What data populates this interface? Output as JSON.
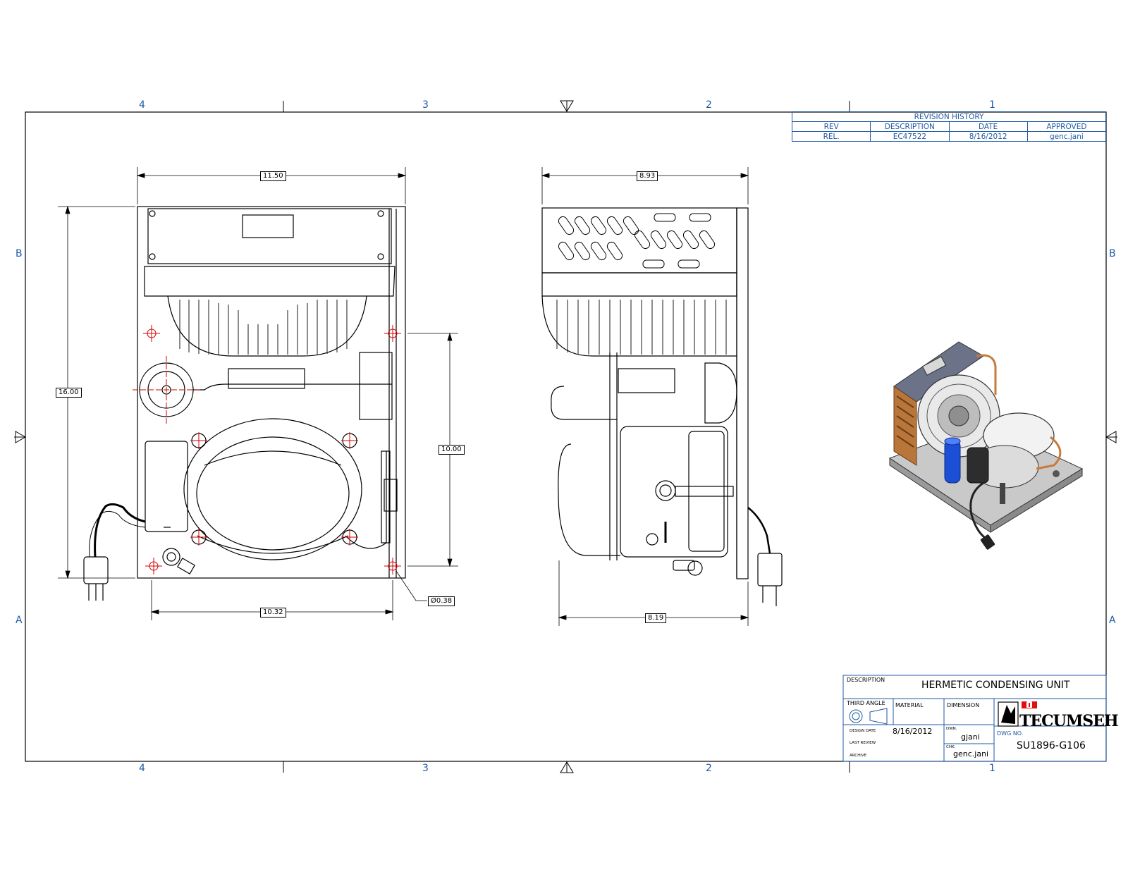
{
  "zones": {
    "columns": [
      "4",
      "3",
      "2",
      "1"
    ],
    "rows": [
      "B",
      "A"
    ]
  },
  "revision_history": {
    "title": "REVISION HISTORY",
    "headers": [
      "REV",
      "DESCRIPTION",
      "DATE",
      "APPROVED"
    ],
    "rows": [
      [
        "REL.",
        "EC47522",
        "8/16/2012",
        "genc.jani"
      ]
    ]
  },
  "dimensions": {
    "front_width": "11.50",
    "front_height": "16.00",
    "mount_spacing_vertical": "10.00",
    "mount_spacing_horizontal": "10.32",
    "hole_diameter": "Ø0.38",
    "side_width": "8.93",
    "side_base": "8.19"
  },
  "title_block": {
    "description_label": "DESCRIPTION",
    "description": "HERMETIC CONDENSING UNIT",
    "third_angle_label": "THIRD ANGLE",
    "material_label": "MATERIAL",
    "dimension_label": "DIMENSION",
    "design_date_label": "DESIGN DATE",
    "design_date": "8/16/2012",
    "last_review_label": "LAST REVIEW",
    "archive_label": "ARCHIVE",
    "drawn_label": "DWN.",
    "drawn_by": "gjani",
    "checked_label": "CHK.",
    "checked_by": "genc.jani",
    "dwg_no_label": "DWG NO.",
    "dwg_no": "SU1896-G106",
    "logo_text": "TECUMSEH"
  },
  "colors": {
    "frame_blue": "#1f5aa6",
    "line": "#000000",
    "center_mark": "#d40000",
    "capacitor": "#1a4fd6",
    "copper": "#c87a3a"
  }
}
